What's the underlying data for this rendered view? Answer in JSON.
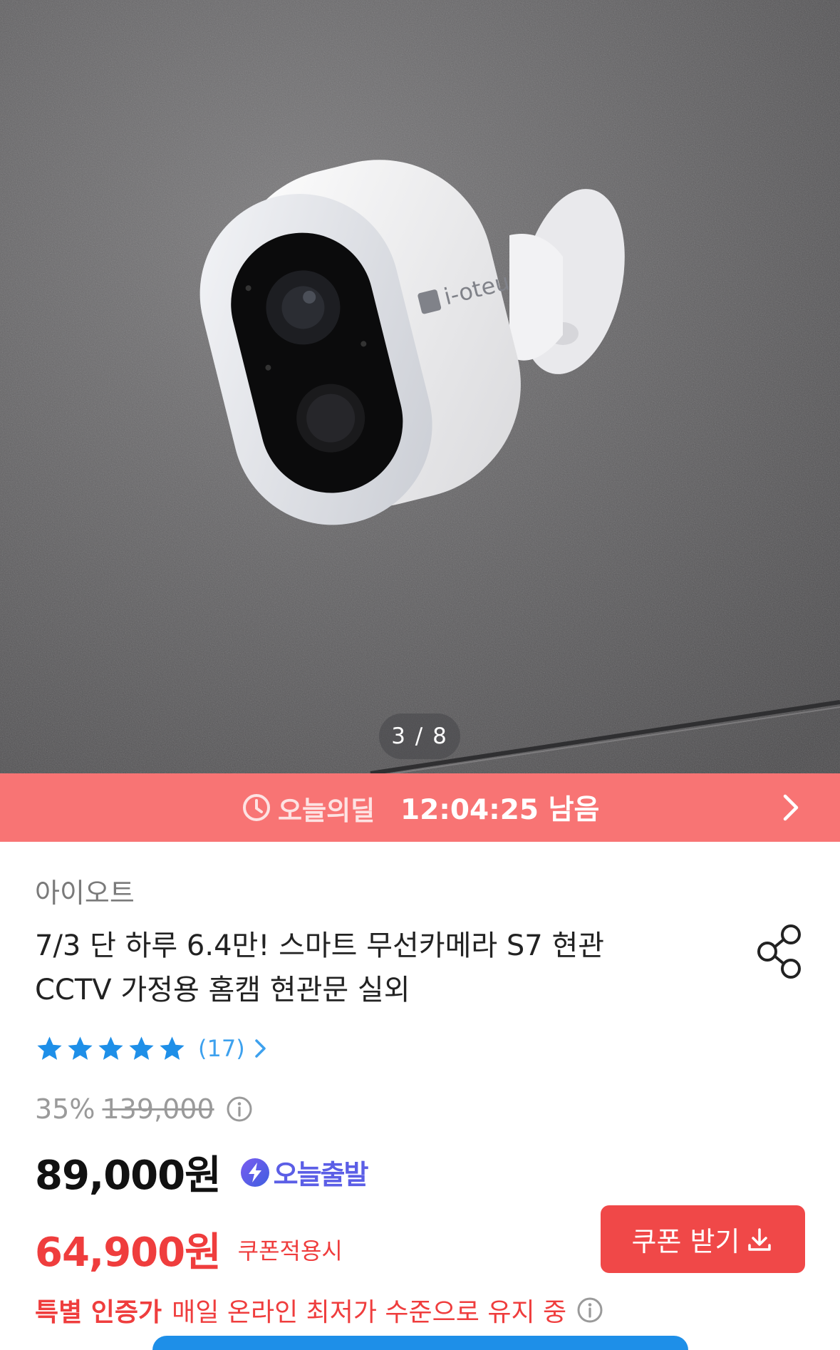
{
  "gallery": {
    "logo_text": "i-oteu",
    "indicator": "3 / 8",
    "current": 3,
    "total": 8
  },
  "deal": {
    "label": "오늘의딜",
    "countdown": "12:04:25 남음",
    "icon": "clock-icon",
    "background": "#f87474"
  },
  "product": {
    "brand": "아이오트",
    "title_line1": "7/3 단 하루 6.4만! 스마트 무선카메라 S7 현관",
    "title_line2": "CCTV 가정용 홈캠 현관문 실외",
    "rating_stars": 5,
    "review_count": "(17)"
  },
  "pricing": {
    "discount_rate": "35%",
    "original_price": "139,000",
    "sale_price": "89,000원",
    "shipping_badge": "오늘출발",
    "coupon_price": "64,900원",
    "coupon_note": "쿠폰적용시",
    "coupon_button": "쿠폰 받기",
    "special_label": "특별 인증가",
    "special_text": "매일 온라인 최저가 수준으로 유지 중"
  },
  "colors": {
    "accent_red": "#ef3d3d",
    "star_blue": "#1e8fe8",
    "shipping_purple": "#5b5ee6"
  }
}
